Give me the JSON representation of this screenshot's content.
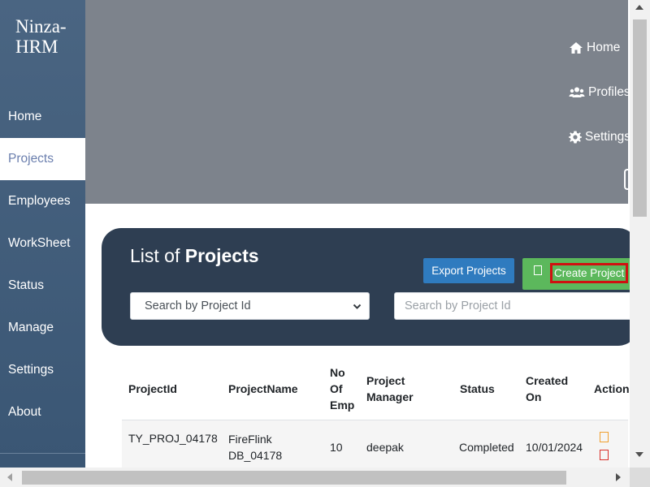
{
  "sidebar": {
    "brand_line1": "Ninza-",
    "brand_line2": "HRM",
    "items": [
      {
        "label": "Home"
      },
      {
        "label": "Projects",
        "active": true
      },
      {
        "label": "Employees"
      },
      {
        "label": "WorkSheet"
      },
      {
        "label": "Status"
      },
      {
        "label": "Manage"
      },
      {
        "label": "Settings"
      },
      {
        "label": "About"
      }
    ]
  },
  "header": {
    "links": [
      {
        "label": "Home",
        "icon": "home-icon"
      },
      {
        "label": "Profiles",
        "icon": "users-icon"
      },
      {
        "label": "Settings",
        "icon": "gear-icon"
      }
    ]
  },
  "projects_card": {
    "title_prefix": "List of",
    "title_bold": "Projects",
    "export_label": "Export Projects",
    "create_label": "Create Project",
    "select_value": "Search by Project Id",
    "search_placeholder": "Search by Project Id"
  },
  "table": {
    "headers": [
      "ProjectId",
      "ProjectName",
      "No Of Emp",
      "Project Manager",
      "Status",
      "Created On",
      "Action"
    ],
    "rows": [
      {
        "project_id": "TY_PROJ_04178",
        "project_name": "FireFlink DB_04178",
        "no_of_emp": "10",
        "project_manager": "deepak",
        "status": "Completed",
        "created_on": "10/01/2024"
      }
    ]
  },
  "colors": {
    "sidebar": "#3f5a78",
    "header": "#7d838c",
    "card": "#2e3e52",
    "export_button": "#2f7bbf",
    "create_button": "#5cb85c",
    "active_nav_text": "#6b7fae",
    "highlight_border": "#d01010"
  }
}
